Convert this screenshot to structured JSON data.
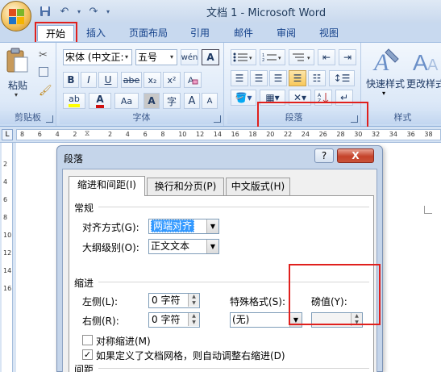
{
  "window": {
    "title": "文档 1 - Microsoft Word"
  },
  "qat": {
    "save_icon": "save-icon",
    "undo_symbol": "↶",
    "redo_symbol": "↷"
  },
  "tabs": [
    {
      "label": "开始",
      "active": true
    },
    {
      "label": "插入"
    },
    {
      "label": "页面布局"
    },
    {
      "label": "引用"
    },
    {
      "label": "邮件"
    },
    {
      "label": "审阅"
    },
    {
      "label": "视图"
    }
  ],
  "ribbon": {
    "clipboard": {
      "paste_label": "粘贴",
      "group_label": "剪贴板"
    },
    "font": {
      "font_name": "宋体 (中文正:",
      "font_size": "五号",
      "bold": "B",
      "italic": "I",
      "underline": "U",
      "strike": "abe",
      "sub": "x₂",
      "sup": "x²",
      "case": "Aa",
      "grow": "A",
      "shrink": "A",
      "group_label": "字体"
    },
    "paragraph": {
      "group_label": "段落"
    },
    "styles": {
      "quick_styles": "快速样式",
      "change_styles": "更改样式",
      "group_label": "样式"
    }
  },
  "ruler": {
    "numbers": [
      "8",
      "6",
      "4",
      "2",
      "",
      "2",
      "4",
      "6",
      "8",
      "10",
      "12",
      "14",
      "16",
      "18",
      "20",
      "22",
      "24",
      "26",
      "28",
      "30",
      "32",
      "34",
      "36",
      "38"
    ],
    "vnumbers": [
      "2",
      "4",
      "6",
      "8",
      "10",
      "12",
      "14",
      "16"
    ]
  },
  "dialog": {
    "title": "段落",
    "help": "?",
    "close": "X",
    "tabs": [
      "缩进和间距(I)",
      "换行和分页(P)",
      "中文版式(H)"
    ],
    "general": {
      "heading": "常规",
      "alignment_label": "对齐方式(G):",
      "alignment_value": "两端对齐",
      "outline_label": "大纲级别(O):",
      "outline_value": "正文文本"
    },
    "indent": {
      "heading": "缩进",
      "left_label": "左侧(L):",
      "left_value": "0 字符",
      "right_label": "右侧(R):",
      "right_value": "0 字符",
      "special_label": "特殊格式(S):",
      "special_value": "(无)",
      "by_label": "磅值(Y):",
      "by_value": "",
      "mirror_label": "对称缩进(M)",
      "mirror_checked": false,
      "auto_adjust_label": "如果定义了文档网格，则自动调整右缩进(D)",
      "auto_adjust_checked": true
    },
    "spacing": {
      "heading": "间距"
    }
  },
  "colors": {
    "highlight_red": "#e0201d",
    "font_color": "#d01010",
    "highlight_yellow": "#ffff00"
  }
}
